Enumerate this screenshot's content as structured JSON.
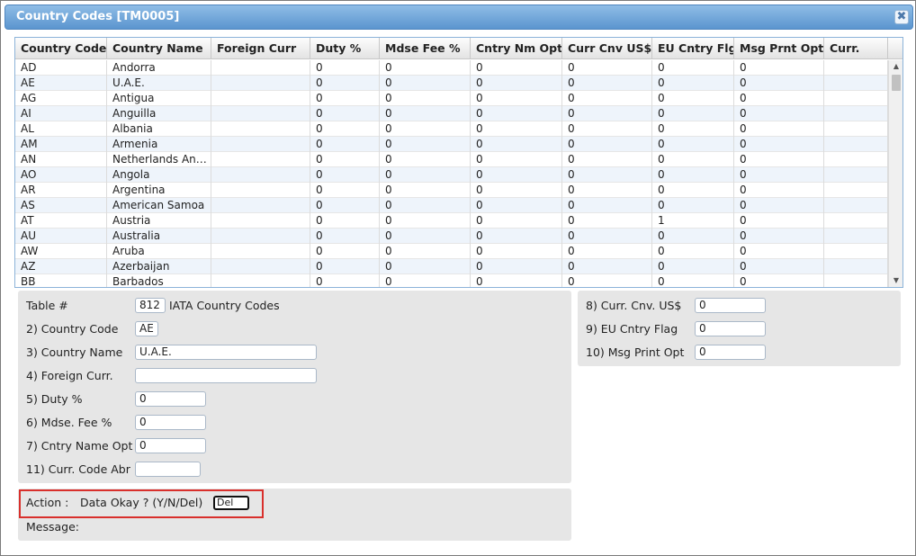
{
  "window": {
    "title": "Country Codes [TM0005]",
    "close_glyph": "✖"
  },
  "grid": {
    "columns": [
      "Country Code",
      "Country Name",
      "Foreign Curr",
      "Duty %",
      "Mdse Fee %",
      "Cntry Nm Opt",
      "Curr Cnv US$",
      "EU Cntry Flg",
      "Msg Prnt Opt",
      "Curr."
    ],
    "rows": [
      [
        "AD",
        "Andorra",
        "",
        "0",
        "0",
        "0",
        "0",
        "0",
        "0",
        ""
      ],
      [
        "AE",
        "U.A.E.",
        "",
        "0",
        "0",
        "0",
        "0",
        "0",
        "0",
        ""
      ],
      [
        "AG",
        "Antigua",
        "",
        "0",
        "0",
        "0",
        "0",
        "0",
        "0",
        ""
      ],
      [
        "AI",
        "Anguilla",
        "",
        "0",
        "0",
        "0",
        "0",
        "0",
        "0",
        ""
      ],
      [
        "AL",
        "Albania",
        "",
        "0",
        "0",
        "0",
        "0",
        "0",
        "0",
        ""
      ],
      [
        "AM",
        "Armenia",
        "",
        "0",
        "0",
        "0",
        "0",
        "0",
        "0",
        ""
      ],
      [
        "AN",
        "Netherlands Ant…",
        "",
        "0",
        "0",
        "0",
        "0",
        "0",
        "0",
        ""
      ],
      [
        "AO",
        "Angola",
        "",
        "0",
        "0",
        "0",
        "0",
        "0",
        "0",
        ""
      ],
      [
        "AR",
        "Argentina",
        "",
        "0",
        "0",
        "0",
        "0",
        "0",
        "0",
        ""
      ],
      [
        "AS",
        "American Samoa",
        "",
        "0",
        "0",
        "0",
        "0",
        "0",
        "0",
        ""
      ],
      [
        "AT",
        "Austria",
        "",
        "0",
        "0",
        "0",
        "0",
        "1",
        "0",
        ""
      ],
      [
        "AU",
        "Australia",
        "",
        "0",
        "0",
        "0",
        "0",
        "0",
        "0",
        ""
      ],
      [
        "AW",
        "Aruba",
        "",
        "0",
        "0",
        "0",
        "0",
        "0",
        "0",
        ""
      ],
      [
        "AZ",
        "Azerbaijan",
        "",
        "0",
        "0",
        "0",
        "0",
        "0",
        "0",
        ""
      ],
      [
        "BB",
        "Barbados",
        "",
        "0",
        "0",
        "0",
        "0",
        "0",
        "0",
        ""
      ]
    ],
    "scroll_up": "▲",
    "scroll_down": "▼"
  },
  "form": {
    "table_label": "Table #",
    "table_value": "812",
    "table_desc": "IATA Country Codes",
    "country_code_label": "2) Country Code",
    "country_code_value": "AE",
    "country_name_label": "3) Country Name",
    "country_name_value": "U.A.E.",
    "foreign_curr_label": "4) Foreign Curr.",
    "foreign_curr_value": "",
    "duty_label": "5) Duty %",
    "duty_value": "0",
    "mdse_fee_label": "6) Mdse. Fee %",
    "mdse_fee_value": "0",
    "cntry_name_opt_label": "7) Cntry Name Opt",
    "cntry_name_opt_value": "0",
    "curr_code_abr_label": "11) Curr. Code Abr",
    "curr_code_abr_value": "",
    "curr_cnv_label": "8) Curr. Cnv. US$",
    "curr_cnv_value": "0",
    "eu_flag_label": "9) EU Cntry Flag",
    "eu_flag_value": "0",
    "msg_print_label": "10) Msg Print Opt",
    "msg_print_value": "0"
  },
  "action": {
    "label": "Action :",
    "prompt": "Data Okay ? (Y/N/Del)",
    "value": "Del",
    "message_label": "Message:"
  },
  "colors": {
    "highlight": "#d9302c",
    "title_bar": "#5b95cf",
    "row_alt": "#eef4fb"
  }
}
